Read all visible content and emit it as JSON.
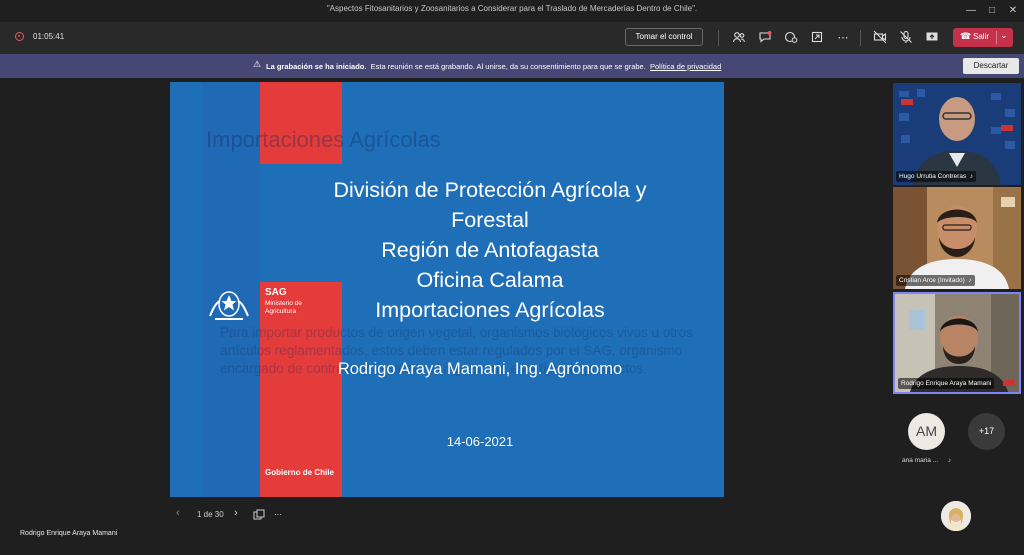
{
  "window": {
    "title": "\"Aspectos Fitosanitarios y Zoosanitarios a Considerar para el Traslado de Mercaderías Dentro de Chile\"."
  },
  "toolbar": {
    "timer": "01:05:41",
    "take_control": "Tomar el control",
    "leave_label": "Salir"
  },
  "banner": {
    "bold": "La grabación se ha iniciado.",
    "text": "Esta reunión se está grabando. Al unirse, da su consentimiento para que se grabe.",
    "link": "Política de privacidad",
    "dismiss": "Descartar"
  },
  "slide": {
    "ghost_title": "Importaciones Agrícolas",
    "ghost_para": "Para importar productos de origen vegetal, organismos biológicos vivos u otros artículos reglamentados, estos deben estar regulados por el SAG, organismo encargado de controlar y fiscalizar el ingreso de este tipo de productos.",
    "sag": "SAG",
    "ministerio": "Ministerio de Agricultura",
    "gobierno": "Gobierno de Chile",
    "lines": [
      "División de Protección Agrícola y",
      "Forestal",
      "Región de Antofagasta",
      "Oficina Calama",
      "Importaciones Agrícolas"
    ],
    "author": "Rodrigo Araya Mamani, Ing. Agrónomo",
    "date": "14-06-2021"
  },
  "slide_nav": {
    "page": "1 de 30"
  },
  "participants": {
    "tiles": [
      {
        "name": "Hugo Urrutia Contreras"
      },
      {
        "name": "Cristian Arce (Invitado)"
      },
      {
        "name": "Rodrigo Enrique Araya Mamani"
      }
    ],
    "avatar_initials": "AM",
    "avatar_name": "ana maria ...",
    "more_count": "+17"
  },
  "presenter": "Rodrigo Enrique Araya Mamani"
}
